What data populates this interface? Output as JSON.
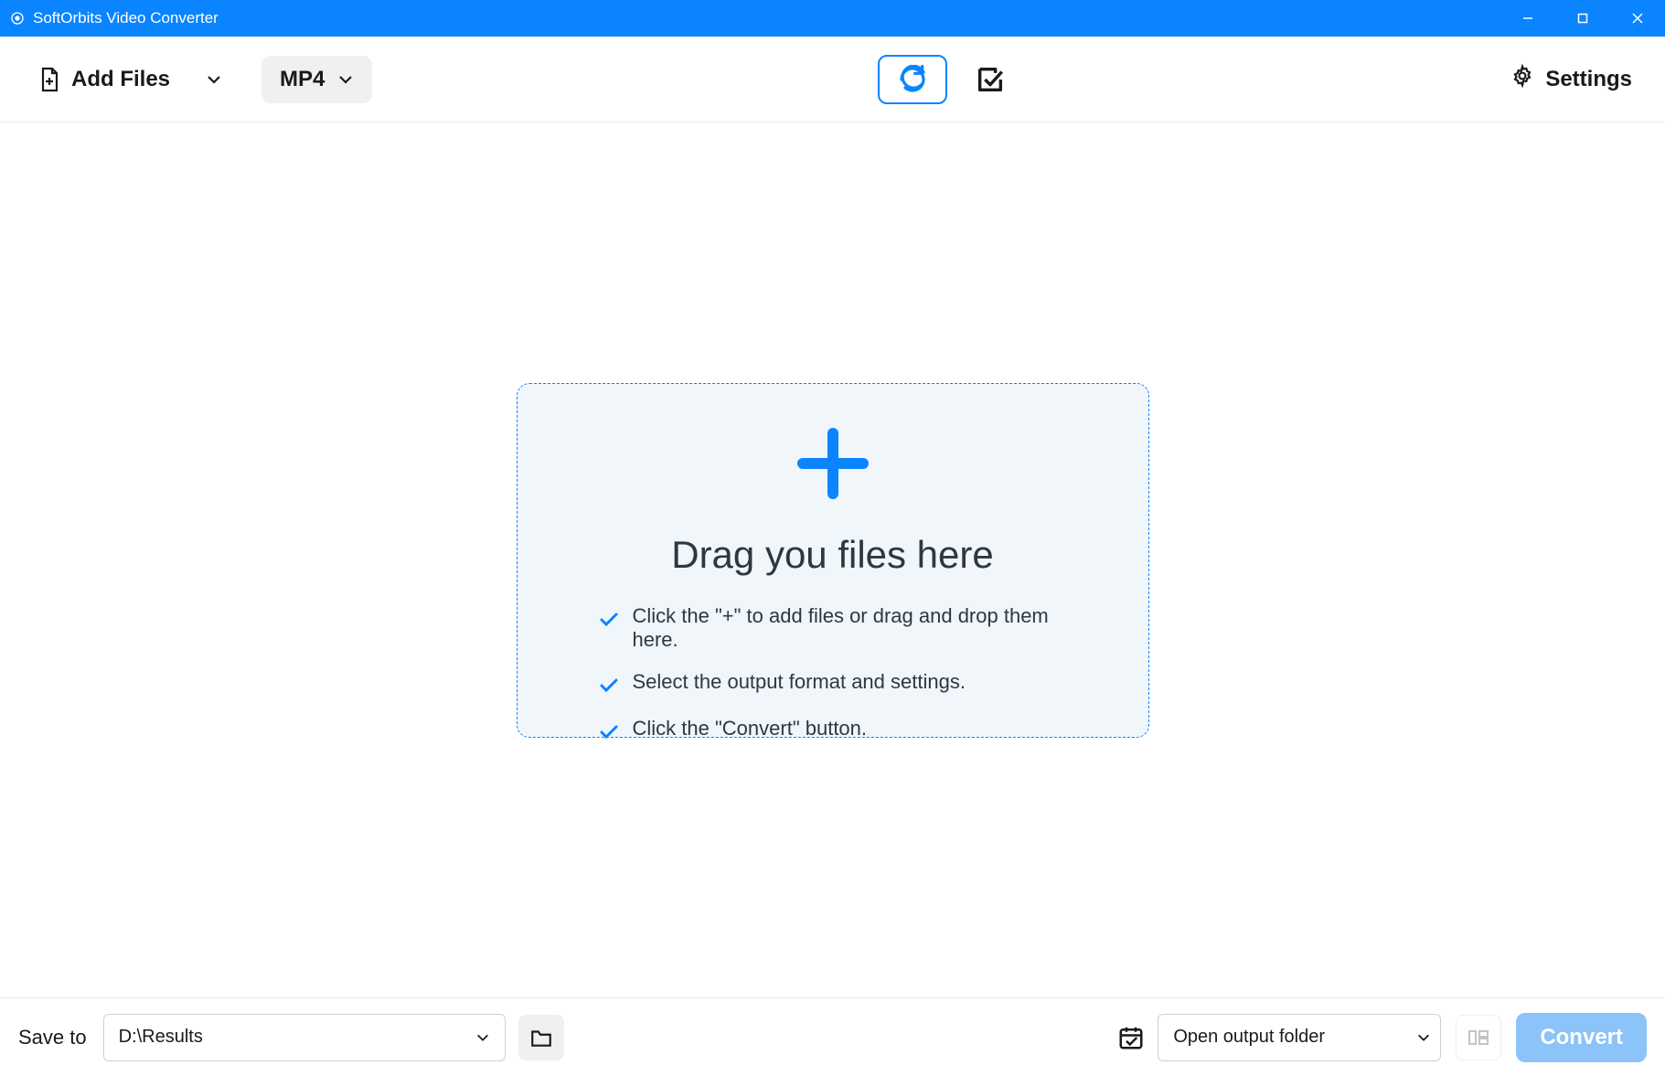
{
  "window": {
    "title": "SoftOrbits Video Converter"
  },
  "toolbar": {
    "add_files_label": "Add Files",
    "format_selected": "MP4",
    "settings_label": "Settings"
  },
  "dropzone": {
    "title": "Drag you files here",
    "hints": [
      "Click the \"+\" to add files or drag and drop them here.",
      "Select the output format and settings.",
      "Click the \"Convert\" button."
    ]
  },
  "bottom": {
    "save_to_label": "Save to",
    "save_path": "D:\\Results",
    "open_output_label": "Open output folder",
    "convert_label": "Convert"
  },
  "colors": {
    "accent": "#0a84ff",
    "panel_bg": "#f1f6fb"
  }
}
